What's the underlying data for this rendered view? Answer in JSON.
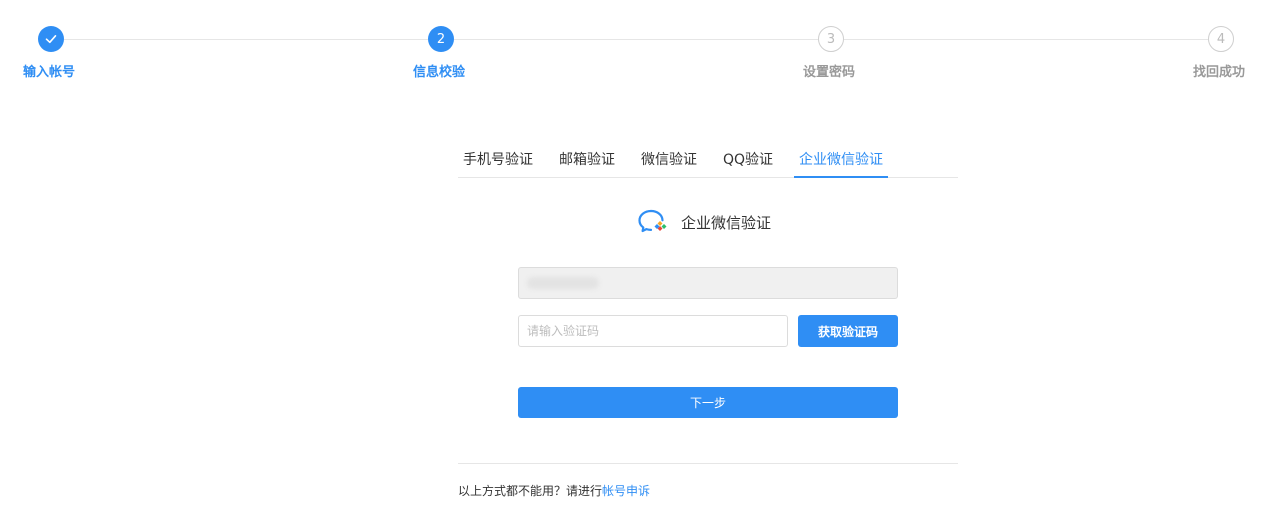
{
  "stepper": {
    "steps": [
      {
        "number": "",
        "label": "输入帐号",
        "state": "done"
      },
      {
        "number": "2",
        "label": "信息校验",
        "state": "active"
      },
      {
        "number": "3",
        "label": "设置密码",
        "state": "todo"
      },
      {
        "number": "4",
        "label": "找回成功",
        "state": "todo"
      }
    ]
  },
  "tabs": [
    {
      "label": "手机号验证"
    },
    {
      "label": "邮箱验证"
    },
    {
      "label": "微信验证"
    },
    {
      "label": "QQ验证"
    },
    {
      "label": "企业微信验证",
      "active": true
    }
  ],
  "section": {
    "icon": "wecom-icon",
    "title": "企业微信验证"
  },
  "form": {
    "account_value": "",
    "code_placeholder": "请输入验证码",
    "get_code_label": "获取验证码",
    "next_label": "下一步"
  },
  "footer": {
    "prefix": "以上方式都不能用？请进行",
    "link_label": "帐号申诉"
  },
  "colors": {
    "accent": "#2f8ef4",
    "muted": "#999999",
    "border": "#dcdcdc"
  }
}
